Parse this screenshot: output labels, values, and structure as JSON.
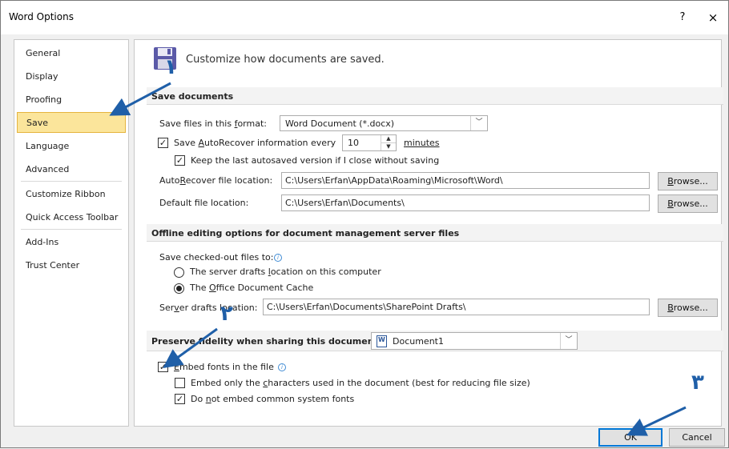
{
  "window": {
    "title": "Word Options",
    "help": "?",
    "close": "×"
  },
  "sidebar": {
    "items": [
      {
        "label": "General"
      },
      {
        "label": "Display"
      },
      {
        "label": "Proofing"
      },
      {
        "label": "Save"
      },
      {
        "label": "Language"
      },
      {
        "label": "Advanced"
      },
      {
        "label": "Customize Ribbon"
      },
      {
        "label": "Quick Access Toolbar"
      },
      {
        "label": "Add-Ins"
      },
      {
        "label": "Trust Center"
      }
    ],
    "selected": "Save"
  },
  "header": {
    "text": "Customize how documents are saved."
  },
  "save_documents": {
    "title": "Save documents",
    "format_label": [
      "Save files in this ",
      "f",
      "ormat:"
    ],
    "format_value": "Word Document (*.docx)",
    "autorecover_label": [
      "Save ",
      "A",
      "utoRecover information every"
    ],
    "autorecover_checked": true,
    "autorecover_minutes": "10",
    "minutes_label": "minutes",
    "keep_last_label": "Keep the last autosaved version if I close without saving",
    "keep_last_checked": true,
    "ar_location_label": [
      "Auto",
      "R",
      "ecover file location:"
    ],
    "ar_location_value": "C:\\Users\\Erfan\\AppData\\Roaming\\Microsoft\\Word\\",
    "default_location_label": [
      "Default f",
      "i",
      "le location:"
    ],
    "default_location_value": "C:\\Users\\Erfan\\Documents\\",
    "browse_label": [
      "",
      "B",
      "rowse..."
    ]
  },
  "offline": {
    "title": "Offline editing options for document management server files",
    "checked_out_label": "Save checked-out files to:",
    "radio1_label": [
      "The server drafts ",
      "l",
      "ocation on this computer"
    ],
    "radio1_selected": false,
    "radio2_label": [
      "The ",
      "O",
      "ffice Document Cache"
    ],
    "radio2_selected": true,
    "server_drafts_label": [
      "Ser",
      "v",
      "er drafts location:"
    ],
    "server_drafts_value": "C:\\Users\\Erfan\\Documents\\SharePoint Drafts\\",
    "browse_label": [
      "",
      "B",
      "rowse..."
    ]
  },
  "fidelity": {
    "title": "Preserve fidelity when sharing this document:",
    "document_value": "Document1",
    "embed_fonts_label": [
      "",
      "E",
      "mbed fonts in the file"
    ],
    "embed_fonts_checked": true,
    "embed_only_label": [
      "Embed only the ",
      "c",
      "haracters used in the document (best for reducing file size)"
    ],
    "embed_only_checked": false,
    "no_common_label": [
      "Do ",
      "n",
      "ot embed common system fonts"
    ],
    "no_common_checked": true
  },
  "footer": {
    "ok_label": "OK",
    "cancel_label": "Cancel"
  },
  "annotations": {
    "a1": "۱",
    "a2": "۲",
    "a3": "۳",
    "color": "#1f5fa8"
  },
  "colors": {
    "selected_bg": "#fbe59b",
    "selected_border": "#e5b43e",
    "default_button_border": "#0078d7"
  }
}
